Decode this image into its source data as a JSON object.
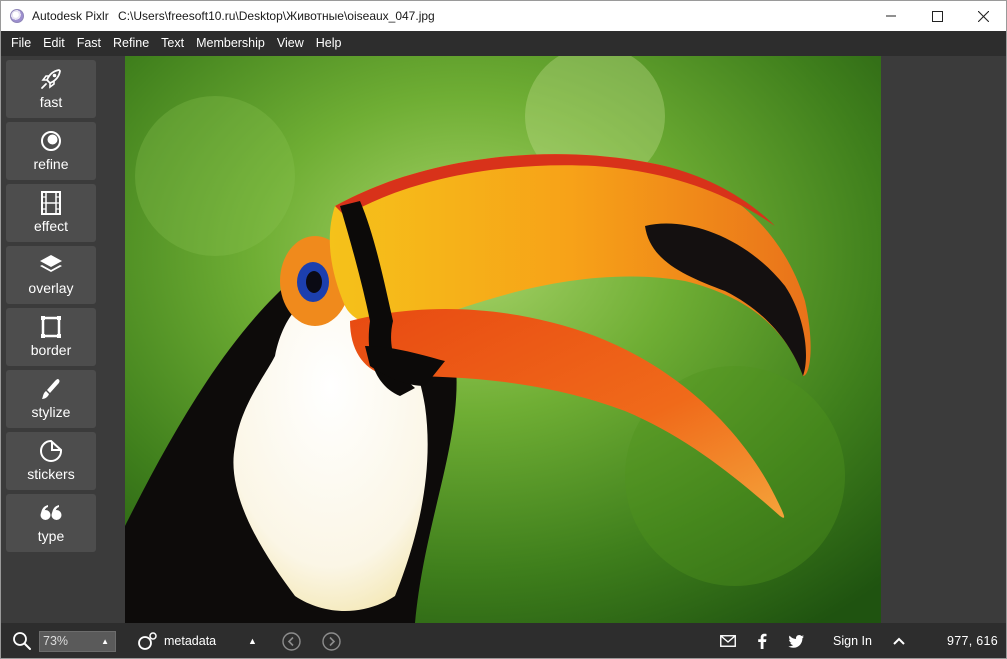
{
  "window": {
    "app_name": "Autodesk Pixlr",
    "file_path": "C:\\Users\\freesoft10.ru\\Desktop\\Животные\\oiseaux_047.jpg"
  },
  "menu": [
    "File",
    "Edit",
    "Fast",
    "Refine",
    "Text",
    "Membership",
    "View",
    "Help"
  ],
  "tools": [
    {
      "label": "fast",
      "icon": "rocket-icon"
    },
    {
      "label": "refine",
      "icon": "circles-icon"
    },
    {
      "label": "effect",
      "icon": "film-strip-icon"
    },
    {
      "label": "overlay",
      "icon": "layers-icon"
    },
    {
      "label": "border",
      "icon": "frame-icon"
    },
    {
      "label": "stylize",
      "icon": "brush-icon"
    },
    {
      "label": "stickers",
      "icon": "sticker-icon"
    },
    {
      "label": "type",
      "icon": "quote-icon"
    }
  ],
  "canvas": {
    "image_subject": "toucan-photo"
  },
  "statusbar": {
    "zoom": "73%",
    "metadata_label": "metadata",
    "sign_in": "Sign In",
    "coordinates": "977, 616"
  },
  "colors": {
    "chrome_dark": "#2d2d2d",
    "workspace": "#3b3b3b",
    "tool_button": "#4d4d4d"
  }
}
